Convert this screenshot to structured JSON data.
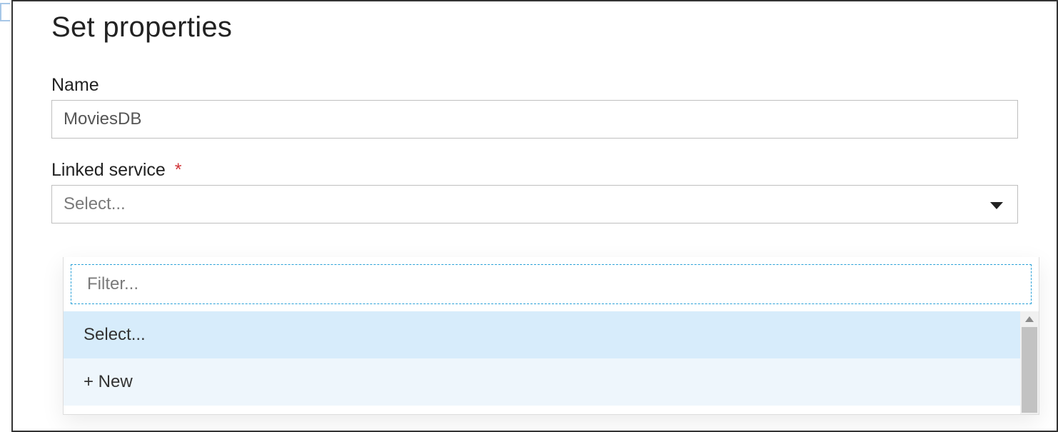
{
  "page": {
    "title": "Set properties"
  },
  "fields": {
    "name": {
      "label": "Name",
      "value": "MoviesDB"
    },
    "linked_service": {
      "label": "Linked service",
      "required_marker": "*",
      "placeholder": "Select..."
    }
  },
  "dropdown": {
    "filter_placeholder": "Filter...",
    "options": {
      "select": "Select...",
      "new": "+ New"
    }
  }
}
